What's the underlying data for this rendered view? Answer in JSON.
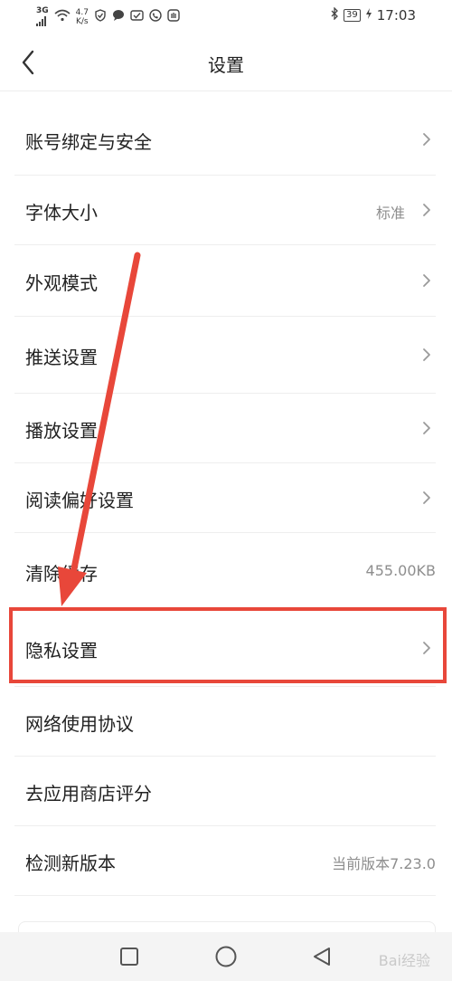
{
  "status_bar": {
    "network": "3G",
    "speed_value": "4.7",
    "speed_unit": "K/s",
    "battery": "39",
    "time": "17:03"
  },
  "header": {
    "title": "设置"
  },
  "settings": [
    {
      "label": "账号绑定与安全",
      "value": "",
      "chevron": true
    },
    {
      "label": "字体大小",
      "value": "标准",
      "chevron": true
    },
    {
      "label": "外观模式",
      "value": "",
      "chevron": true
    },
    {
      "label": "推送设置",
      "value": "",
      "chevron": true
    },
    {
      "label": "播放设置",
      "value": "",
      "chevron": true
    },
    {
      "label": "阅读偏好设置",
      "value": "",
      "chevron": true
    },
    {
      "label": "清除缓存",
      "value": "455.00KB",
      "chevron": false
    },
    {
      "label": "隐私设置",
      "value": "",
      "chevron": true
    },
    {
      "label": "网络使用协议",
      "value": "",
      "chevron": false
    },
    {
      "label": "去应用商店评分",
      "value": "",
      "chevron": false
    },
    {
      "label": "检测新版本",
      "value": "当前版本7.23.0",
      "chevron": false
    }
  ],
  "watermark": "Bai经验",
  "annotation_color": "#e8473a"
}
